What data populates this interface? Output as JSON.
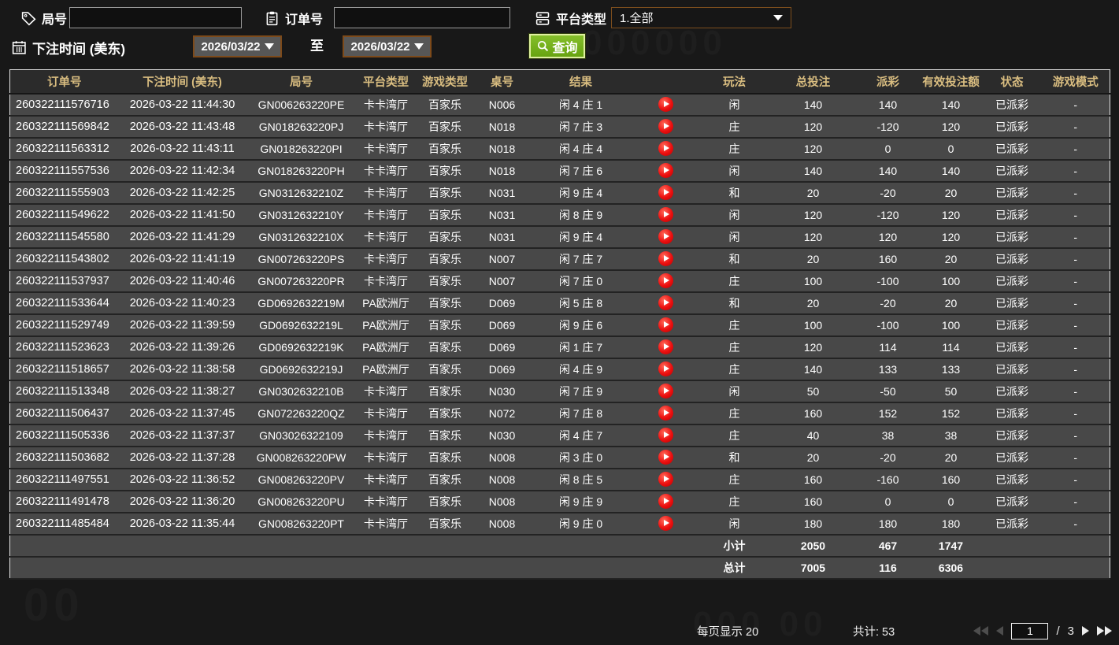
{
  "filters": {
    "round": {
      "label": "局号",
      "value": ""
    },
    "order": {
      "label": "订单号",
      "value": ""
    },
    "platform": {
      "label": "平台类型",
      "value": "1.全部"
    },
    "bet_time": {
      "label": "下注时间 (美东)",
      "from": "2026/03/22",
      "to_label": "至",
      "to": "2026/03/22"
    },
    "search_label": "查询"
  },
  "table": {
    "columns": [
      {
        "key": "order_no",
        "label": "订单号"
      },
      {
        "key": "bet_time",
        "label": "下注时间 (美东)"
      },
      {
        "key": "round_no",
        "label": "局号"
      },
      {
        "key": "platform",
        "label": "平台类型"
      },
      {
        "key": "game_type",
        "label": "游戏类型"
      },
      {
        "key": "table_no",
        "label": "桌号"
      },
      {
        "key": "result",
        "label": "结果"
      },
      {
        "key": "video",
        "label": ""
      },
      {
        "key": "play",
        "label": "玩法"
      },
      {
        "key": "total_bet",
        "label": "总投注"
      },
      {
        "key": "payout",
        "label": "派彩"
      },
      {
        "key": "valid_bet",
        "label": "有效投注额"
      },
      {
        "key": "status",
        "label": "状态"
      },
      {
        "key": "mode",
        "label": "游戏模式"
      }
    ],
    "rows": [
      {
        "order_no": "260322111576716",
        "bet_time": "2026-03-22 11:44:30",
        "round_no": "GN006263220PE",
        "platform": "卡卡湾厅",
        "game_type": "百家乐",
        "table_no": "N006",
        "result": "闲 4 庄 1",
        "play": "闲",
        "total_bet": "140",
        "payout": "140",
        "valid_bet": "140",
        "status": "已派彩",
        "mode": "-"
      },
      {
        "order_no": "260322111569842",
        "bet_time": "2026-03-22 11:43:48",
        "round_no": "GN018263220PJ",
        "platform": "卡卡湾厅",
        "game_type": "百家乐",
        "table_no": "N018",
        "result": "闲 7 庄 3",
        "play": "庄",
        "total_bet": "120",
        "payout": "-120",
        "valid_bet": "120",
        "status": "已派彩",
        "mode": "-"
      },
      {
        "order_no": "260322111563312",
        "bet_time": "2026-03-22 11:43:11",
        "round_no": "GN018263220PI",
        "platform": "卡卡湾厅",
        "game_type": "百家乐",
        "table_no": "N018",
        "result": "闲 4 庄 4",
        "play": "庄",
        "total_bet": "120",
        "payout": "0",
        "valid_bet": "0",
        "status": "已派彩",
        "mode": "-"
      },
      {
        "order_no": "260322111557536",
        "bet_time": "2026-03-22 11:42:34",
        "round_no": "GN018263220PH",
        "platform": "卡卡湾厅",
        "game_type": "百家乐",
        "table_no": "N018",
        "result": "闲 7 庄 6",
        "play": "闲",
        "total_bet": "140",
        "payout": "140",
        "valid_bet": "140",
        "status": "已派彩",
        "mode": "-"
      },
      {
        "order_no": "260322111555903",
        "bet_time": "2026-03-22 11:42:25",
        "round_no": "GN0312632210Z",
        "platform": "卡卡湾厅",
        "game_type": "百家乐",
        "table_no": "N031",
        "result": "闲 9 庄 4",
        "play": "和",
        "total_bet": "20",
        "payout": "-20",
        "valid_bet": "20",
        "status": "已派彩",
        "mode": "-"
      },
      {
        "order_no": "260322111549622",
        "bet_time": "2026-03-22 11:41:50",
        "round_no": "GN0312632210Y",
        "platform": "卡卡湾厅",
        "game_type": "百家乐",
        "table_no": "N031",
        "result": "闲 8 庄 9",
        "play": "闲",
        "total_bet": "120",
        "payout": "-120",
        "valid_bet": "120",
        "status": "已派彩",
        "mode": "-"
      },
      {
        "order_no": "260322111545580",
        "bet_time": "2026-03-22 11:41:29",
        "round_no": "GN0312632210X",
        "platform": "卡卡湾厅",
        "game_type": "百家乐",
        "table_no": "N031",
        "result": "闲 9 庄 4",
        "play": "闲",
        "total_bet": "120",
        "payout": "120",
        "valid_bet": "120",
        "status": "已派彩",
        "mode": "-"
      },
      {
        "order_no": "260322111543802",
        "bet_time": "2026-03-22 11:41:19",
        "round_no": "GN007263220PS",
        "platform": "卡卡湾厅",
        "game_type": "百家乐",
        "table_no": "N007",
        "result": "闲 7 庄 7",
        "play": "和",
        "total_bet": "20",
        "payout": "160",
        "valid_bet": "20",
        "status": "已派彩",
        "mode": "-"
      },
      {
        "order_no": "260322111537937",
        "bet_time": "2026-03-22 11:40:46",
        "round_no": "GN007263220PR",
        "platform": "卡卡湾厅",
        "game_type": "百家乐",
        "table_no": "N007",
        "result": "闲 7 庄 0",
        "play": "庄",
        "total_bet": "100",
        "payout": "-100",
        "valid_bet": "100",
        "status": "已派彩",
        "mode": "-"
      },
      {
        "order_no": "260322111533644",
        "bet_time": "2026-03-22 11:40:23",
        "round_no": "GD0692632219M",
        "platform": "PA欧洲厅",
        "game_type": "百家乐",
        "table_no": "D069",
        "result": "闲 5 庄 8",
        "play": "和",
        "total_bet": "20",
        "payout": "-20",
        "valid_bet": "20",
        "status": "已派彩",
        "mode": "-"
      },
      {
        "order_no": "260322111529749",
        "bet_time": "2026-03-22 11:39:59",
        "round_no": "GD0692632219L",
        "platform": "PA欧洲厅",
        "game_type": "百家乐",
        "table_no": "D069",
        "result": "闲 9 庄 6",
        "play": "庄",
        "total_bet": "100",
        "payout": "-100",
        "valid_bet": "100",
        "status": "已派彩",
        "mode": "-"
      },
      {
        "order_no": "260322111523623",
        "bet_time": "2026-03-22 11:39:26",
        "round_no": "GD0692632219K",
        "platform": "PA欧洲厅",
        "game_type": "百家乐",
        "table_no": "D069",
        "result": "闲 1 庄 7",
        "play": "庄",
        "total_bet": "120",
        "payout": "114",
        "valid_bet": "114",
        "status": "已派彩",
        "mode": "-"
      },
      {
        "order_no": "260322111518657",
        "bet_time": "2026-03-22 11:38:58",
        "round_no": "GD0692632219J",
        "platform": "PA欧洲厅",
        "game_type": "百家乐",
        "table_no": "D069",
        "result": "闲 4 庄 9",
        "play": "庄",
        "total_bet": "140",
        "payout": "133",
        "valid_bet": "133",
        "status": "已派彩",
        "mode": "-"
      },
      {
        "order_no": "260322111513348",
        "bet_time": "2026-03-22 11:38:27",
        "round_no": "GN0302632210B",
        "platform": "卡卡湾厅",
        "game_type": "百家乐",
        "table_no": "N030",
        "result": "闲 7 庄 9",
        "play": "闲",
        "total_bet": "50",
        "payout": "-50",
        "valid_bet": "50",
        "status": "已派彩",
        "mode": "-"
      },
      {
        "order_no": "260322111506437",
        "bet_time": "2026-03-22 11:37:45",
        "round_no": "GN072263220QZ",
        "platform": "卡卡湾厅",
        "game_type": "百家乐",
        "table_no": "N072",
        "result": "闲 7 庄 8",
        "play": "庄",
        "total_bet": "160",
        "payout": "152",
        "valid_bet": "152",
        "status": "已派彩",
        "mode": "-"
      },
      {
        "order_no": "260322111505336",
        "bet_time": "2026-03-22 11:37:37",
        "round_no": "GN03026322109",
        "platform": "卡卡湾厅",
        "game_type": "百家乐",
        "table_no": "N030",
        "result": "闲 4 庄 7",
        "play": "庄",
        "total_bet": "40",
        "payout": "38",
        "valid_bet": "38",
        "status": "已派彩",
        "mode": "-"
      },
      {
        "order_no": "260322111503682",
        "bet_time": "2026-03-22 11:37:28",
        "round_no": "GN008263220PW",
        "platform": "卡卡湾厅",
        "game_type": "百家乐",
        "table_no": "N008",
        "result": "闲 3 庄 0",
        "play": "和",
        "total_bet": "20",
        "payout": "-20",
        "valid_bet": "20",
        "status": "已派彩",
        "mode": "-"
      },
      {
        "order_no": "260322111497551",
        "bet_time": "2026-03-22 11:36:52",
        "round_no": "GN008263220PV",
        "platform": "卡卡湾厅",
        "game_type": "百家乐",
        "table_no": "N008",
        "result": "闲 8 庄 5",
        "play": "庄",
        "total_bet": "160",
        "payout": "-160",
        "valid_bet": "160",
        "status": "已派彩",
        "mode": "-"
      },
      {
        "order_no": "260322111491478",
        "bet_time": "2026-03-22 11:36:20",
        "round_no": "GN008263220PU",
        "platform": "卡卡湾厅",
        "game_type": "百家乐",
        "table_no": "N008",
        "result": "闲 9 庄 9",
        "play": "庄",
        "total_bet": "160",
        "payout": "0",
        "valid_bet": "0",
        "status": "已派彩",
        "mode": "-"
      },
      {
        "order_no": "260322111485484",
        "bet_time": "2026-03-22 11:35:44",
        "round_no": "GN008263220PT",
        "platform": "卡卡湾厅",
        "game_type": "百家乐",
        "table_no": "N008",
        "result": "闲 9 庄 0",
        "play": "闲",
        "total_bet": "180",
        "payout": "180",
        "valid_bet": "180",
        "status": "已派彩",
        "mode": "-"
      }
    ],
    "subtotal": {
      "label": "小计",
      "total_bet": "2050",
      "payout": "467",
      "valid_bet": "1747"
    },
    "total": {
      "label": "总计",
      "total_bet": "7005",
      "payout": "116",
      "valid_bet": "6306"
    }
  },
  "footer": {
    "page_size_label": "每页显示 20",
    "total_count_label": "共计: 53",
    "current_page": "1",
    "page_separator": "/",
    "total_pages": "3"
  },
  "colors": {
    "header_gold": "#d9bd80",
    "positive_red": "#d02539",
    "negative_green": "#58e23c",
    "status_green": "#35df35",
    "summary_yellow": "#e9ed1f",
    "search_button_green": "#74ac1c",
    "row_background": "#484848"
  }
}
